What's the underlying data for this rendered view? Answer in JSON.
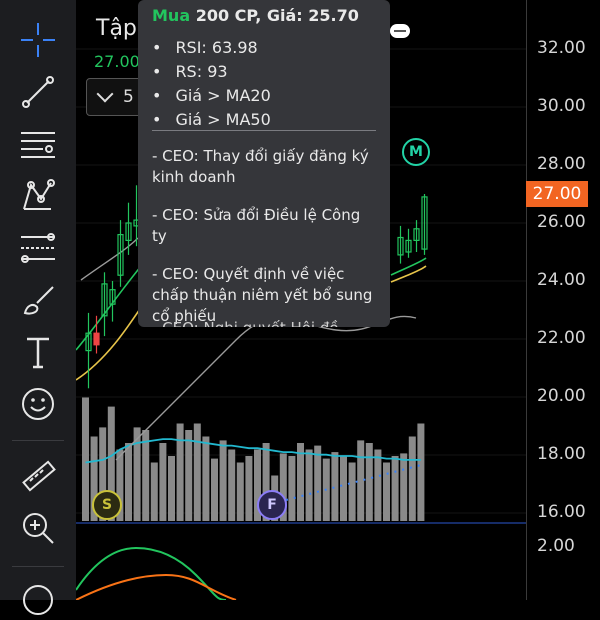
{
  "header": {
    "symbol_title": "Tập",
    "last_price": "27.00",
    "interval_value": "5"
  },
  "tooltip": {
    "action": "Mua",
    "detail": "200 CP, Giá: 25.70",
    "indicators": [
      "RSI: 63.98",
      "RS: 93",
      "Giá > MA20",
      "Giá > MA50"
    ],
    "news": [
      "- CEO: Thay đổi giấy đăng ký kinh doanh",
      "- CEO: Sửa đổi Điều lệ Công ty",
      "- CEO: Quyết định về việc chấp thuận niêm yết bổ sung cổ phiếu"
    ],
    "news_truncated": "- CEO: Nghị quyết Hội đồ..."
  },
  "price_axis": {
    "ticks": [
      "32.00",
      "30.00",
      "28.00",
      "26.00",
      "24.00",
      "22.00",
      "20.00",
      "18.00",
      "16.00"
    ],
    "current_price": "27.00",
    "lower_tick": "2.00"
  },
  "markers": {
    "s": "S",
    "f": "F",
    "m": "M"
  },
  "colors": {
    "accent_tool": "#3b82f6",
    "up": "#22c55e",
    "down": "#ef4444",
    "price_badge": "#f26522",
    "ma_yellow": "#e7c44a",
    "ma_green": "#22c55e",
    "ma_cyan": "#22b8cf"
  },
  "chart_data": {
    "type": "candlestick",
    "y_range": [
      16,
      32
    ],
    "candles": [
      {
        "o": 21.6,
        "h": 22.9,
        "l": 20.3,
        "c": 22.2
      },
      {
        "o": 22.2,
        "h": 22.8,
        "l": 21.5,
        "c": 21.8
      },
      {
        "o": 22.8,
        "h": 24.3,
        "l": 22.1,
        "c": 23.9
      },
      {
        "o": 23.2,
        "h": 24.0,
        "l": 22.6,
        "c": 23.7
      },
      {
        "o": 24.2,
        "h": 26.1,
        "l": 23.8,
        "c": 25.6
      },
      {
        "o": 25.4,
        "h": 26.7,
        "l": 24.9,
        "c": 26.0
      },
      {
        "o": 25.9,
        "h": 27.3,
        "l": 25.2,
        "c": 26.1
      },
      {
        "o": 26.1,
        "h": 27.0,
        "l": 25.6,
        "c": 26.3
      },
      {
        "o": 26.3,
        "h": 27.2,
        "l": 25.9,
        "c": 26.7
      },
      {
        "o": 24.9,
        "h": 25.9,
        "l": 24.6,
        "c": 25.5
      },
      {
        "o": 25.0,
        "h": 25.8,
        "l": 24.8,
        "c": 25.4
      },
      {
        "o": 25.4,
        "h": 26.1,
        "l": 25.0,
        "c": 25.8
      },
      {
        "o": 25.1,
        "h": 27.0,
        "l": 24.9,
        "c": 26.9
      }
    ],
    "volumes": [
      0.95,
      0.65,
      0.72,
      0.88,
      0.55,
      0.6,
      0.72,
      0.7,
      0.45,
      0.6,
      0.5,
      0.75,
      0.7,
      0.75,
      0.65,
      0.48,
      0.62,
      0.55,
      0.45,
      0.5,
      0.55,
      0.6,
      0.35,
      0.52,
      0.5,
      0.6,
      0.55,
      0.58,
      0.48,
      0.53,
      0.5,
      0.45,
      0.62,
      0.6,
      0.55,
      0.45,
      0.5,
      0.52,
      0.65,
      0.75
    ],
    "volume_ma": [
      0.45,
      0.46,
      0.47,
      0.5,
      0.55,
      0.58,
      0.6,
      0.61,
      0.62,
      0.63,
      0.63,
      0.62,
      0.62,
      0.61,
      0.6,
      0.59,
      0.58,
      0.58,
      0.57,
      0.56,
      0.56,
      0.55,
      0.54,
      0.53,
      0.53,
      0.52,
      0.52,
      0.51,
      0.51,
      0.5,
      0.5,
      0.5,
      0.49,
      0.49,
      0.49,
      0.48,
      0.48,
      0.47,
      0.47,
      0.47
    ]
  }
}
